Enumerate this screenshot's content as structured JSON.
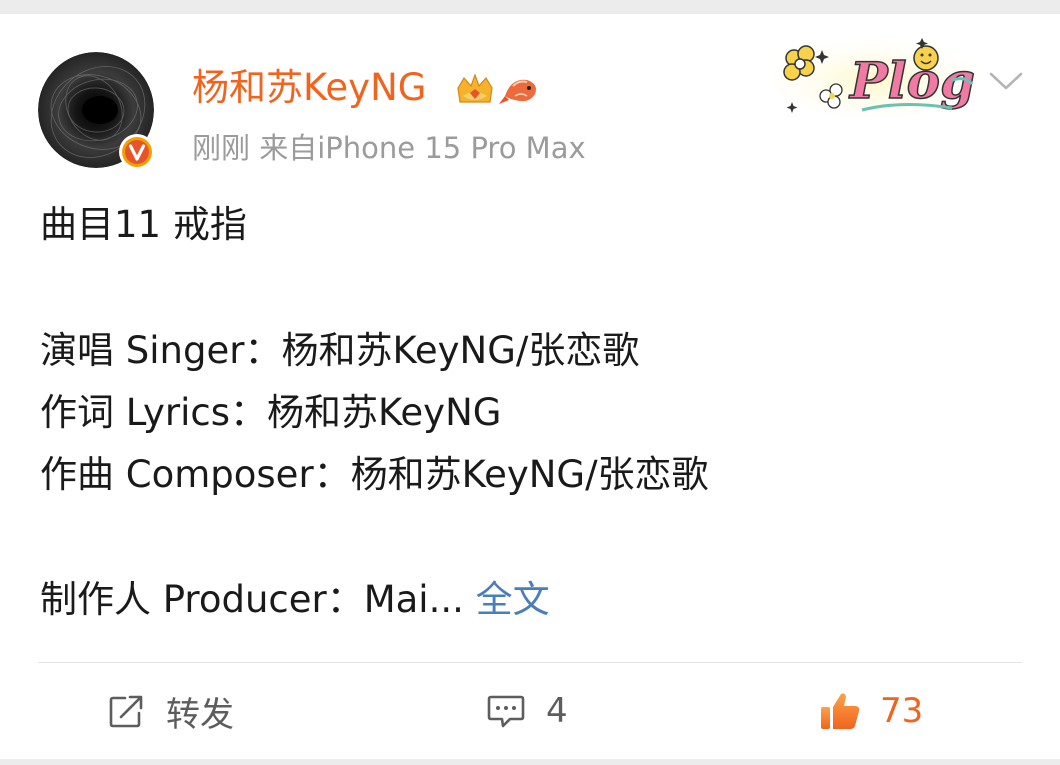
{
  "post": {
    "user_name": "杨和苏KeyNG",
    "meta": "刚刚  来自iPhone 15 Pro Max",
    "line1": "曲目11 戒指",
    "line2": "演唱 Singer：杨和苏KeyNG/张恋歌",
    "line3": "作词 Lyrics：杨和苏KeyNG",
    "line4": "作曲 Composer：杨和苏KeyNG/张恋歌",
    "line5": "制作人 Producer：Mai...",
    "full_text_link": "全文",
    "plog_sticker": "Plog"
  },
  "actions": {
    "repost_label": "转发",
    "comment_count": "4",
    "like_count": "73"
  },
  "colors": {
    "name": "#f1641e",
    "link": "#4a7dbb",
    "meta": "#9b9b9b",
    "like": "#f1641e"
  },
  "icons": [
    "verified-badge-icon",
    "crown-icon",
    "koi-fish-icon",
    "chevron-down-icon",
    "repost-icon",
    "comment-icon",
    "like-icon"
  ]
}
